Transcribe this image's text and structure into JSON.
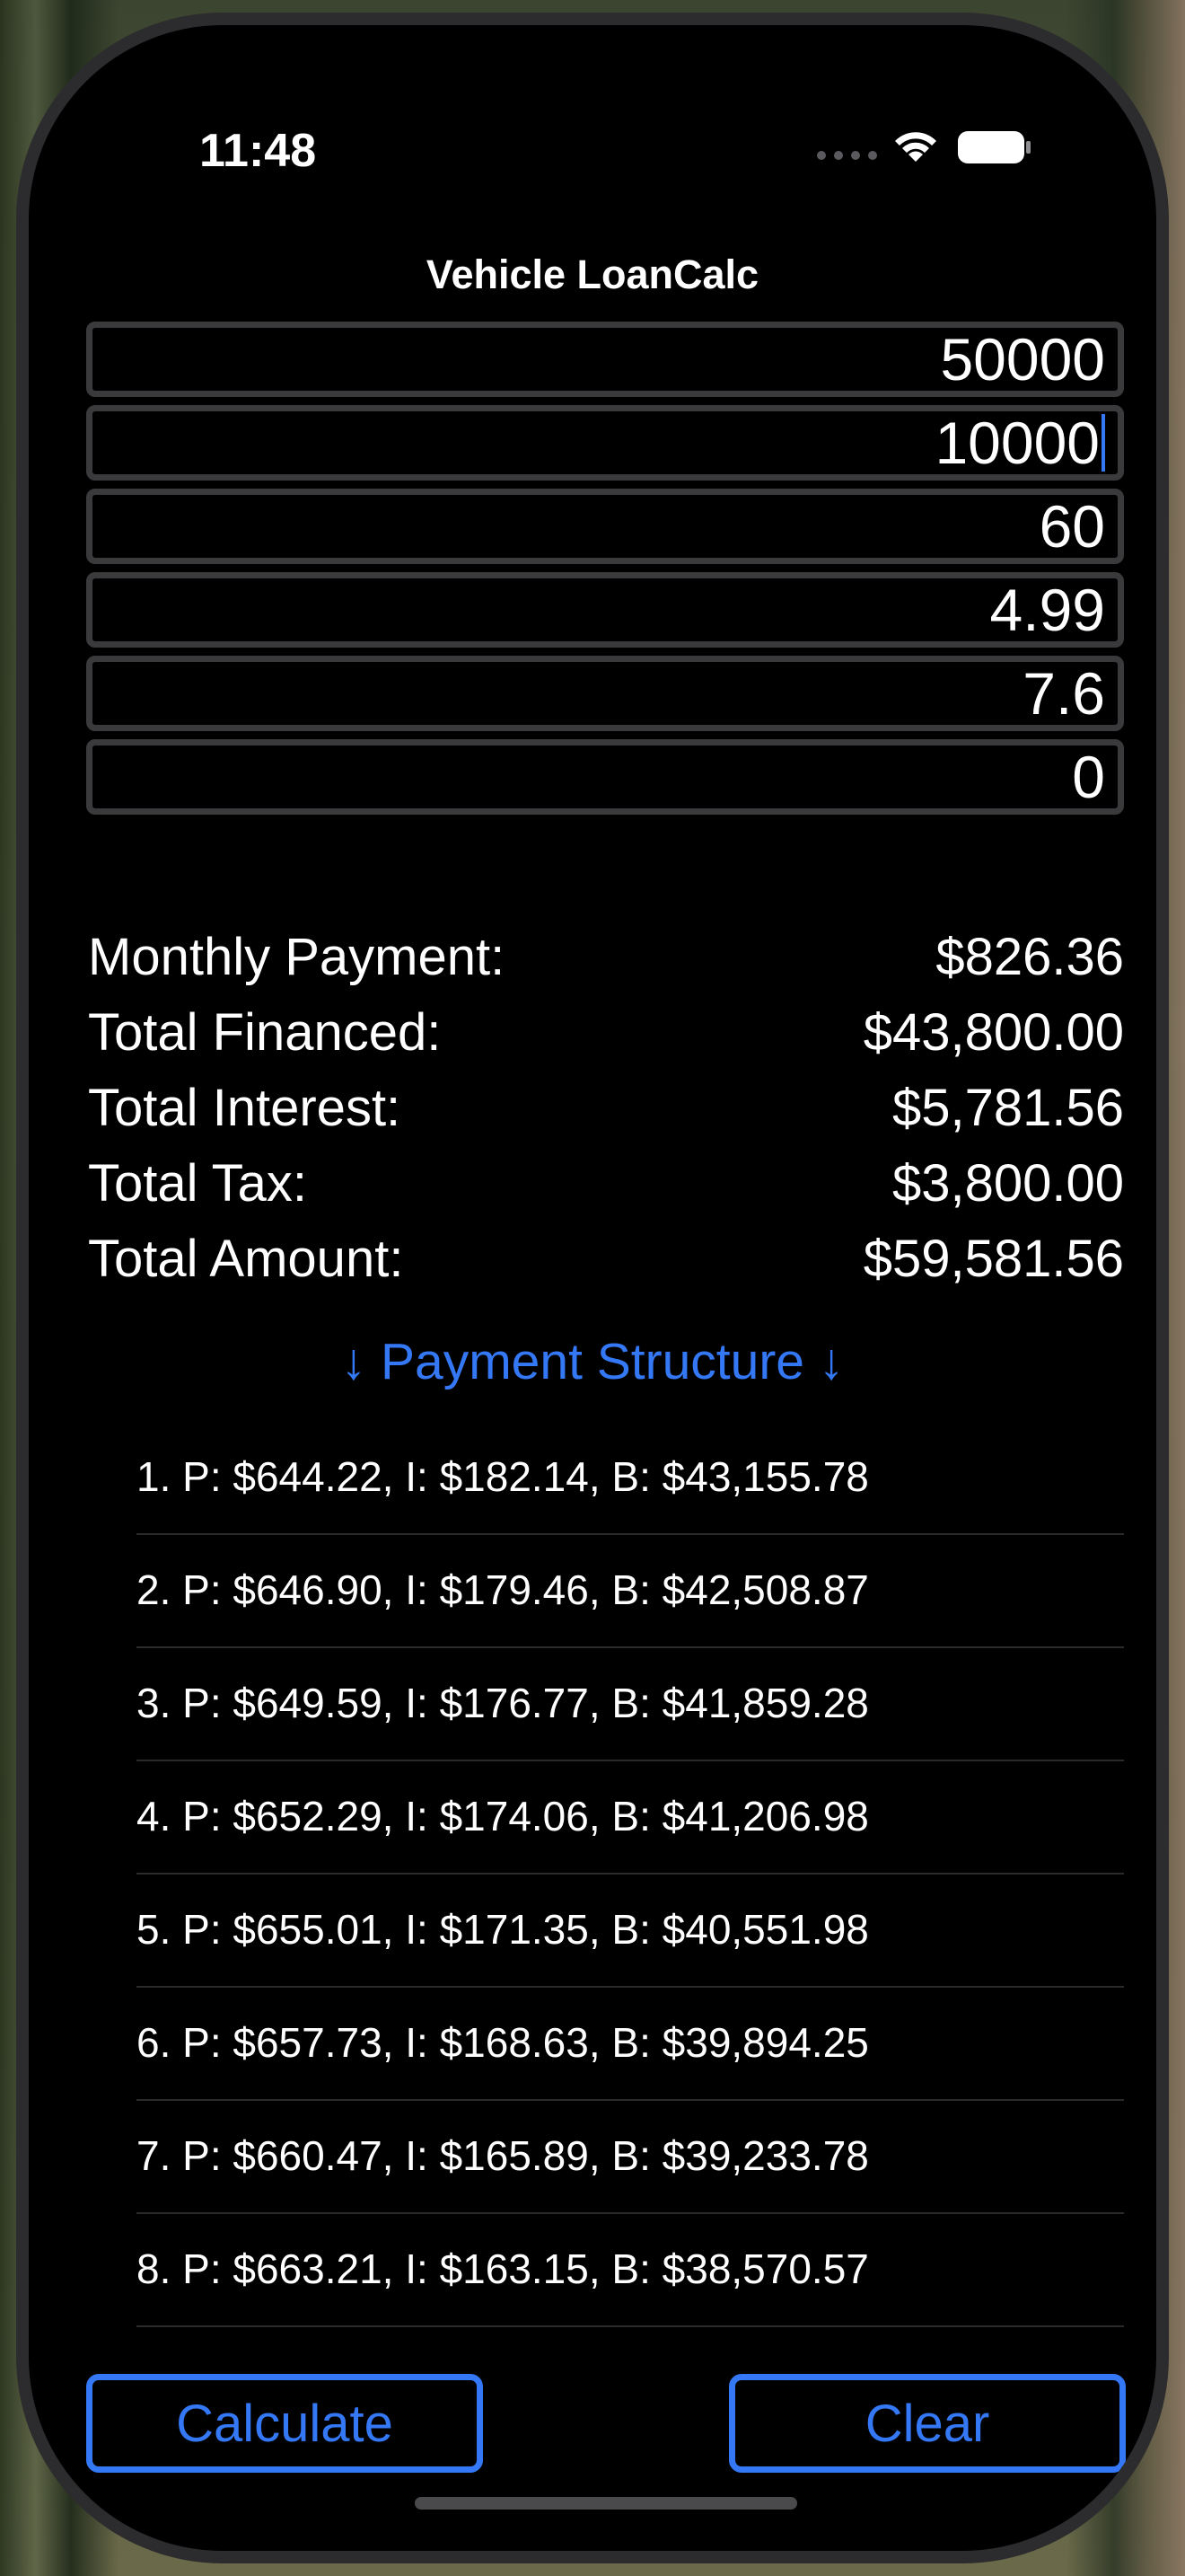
{
  "status_bar": {
    "time": "11:48"
  },
  "nav": {
    "title": "Vehicle LoanCalc"
  },
  "inputs": [
    {
      "value": "50000"
    },
    {
      "value": "10000"
    },
    {
      "value": "60"
    },
    {
      "value": "4.99"
    },
    {
      "value": "7.6"
    },
    {
      "value": "0"
    }
  ],
  "results": [
    {
      "label": "Monthly Payment:",
      "value": "$826.36"
    },
    {
      "label": "Total Financed:",
      "value": "$43,800.00"
    },
    {
      "label": "Total Interest:",
      "value": "$5,781.56"
    },
    {
      "label": "Total Tax:",
      "value": "$3,800.00"
    },
    {
      "label": "Total Amount:",
      "value": "$59,581.56"
    }
  ],
  "structure_header": "↓ Payment Structure ↓",
  "payments": [
    "1. P: $644.22, I: $182.14, B: $43,155.78",
    "2. P: $646.90, I: $179.46, B: $42,508.87",
    "3. P: $649.59, I: $176.77, B: $41,859.28",
    "4. P: $652.29, I: $174.06, B: $41,206.98",
    "5. P: $655.01, I: $171.35, B: $40,551.98",
    "6. P: $657.73, I: $168.63, B: $39,894.25",
    "7. P: $660.47, I: $165.89, B: $39,233.78",
    "8. P: $663.21, I: $163.15, B: $38,570.57"
  ],
  "buttons": {
    "calculate": "Calculate",
    "clear": "Clear"
  },
  "colors": {
    "accent": "#3478f6",
    "background": "#000000",
    "field_border": "#3a3a3c"
  },
  "icons": [
    "signal-icon",
    "wifi-icon",
    "battery-icon"
  ]
}
